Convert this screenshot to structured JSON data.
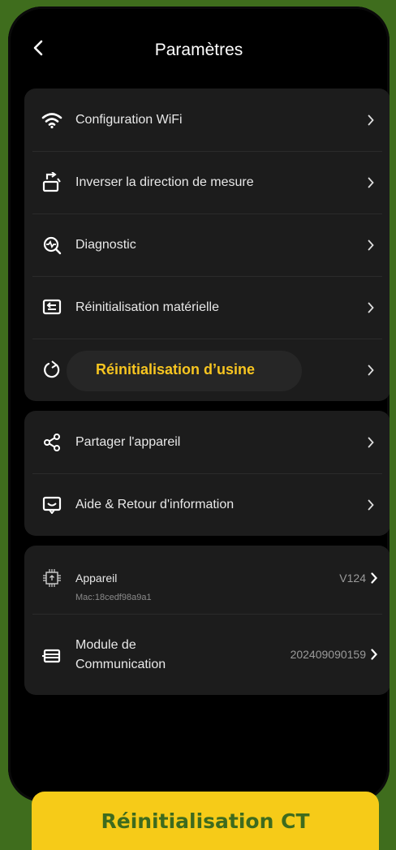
{
  "header": {
    "title": "Paramètres",
    "back_icon": "chevron-left-icon"
  },
  "settings_group1": {
    "items": [
      {
        "label": "Configuration WiFi",
        "icon": "wifi-icon"
      },
      {
        "label": "Inverser la direction de mesure",
        "icon": "rotate-device-icon"
      },
      {
        "label": "Diagnostic",
        "icon": "diagnostic-icon"
      },
      {
        "label": "Réinitialisation matérielle",
        "icon": "hardware-reset-icon"
      },
      {
        "label": "Réinitialisation d’usine",
        "icon": "factory-reset-icon",
        "highlighted": true
      }
    ]
  },
  "settings_group2": {
    "items": [
      {
        "label": "Partager l'appareil",
        "icon": "share-icon"
      },
      {
        "label": "Aide & Retour d'information",
        "icon": "feedback-icon"
      }
    ]
  },
  "device_group": {
    "device": {
      "label": "Appareil",
      "mac": "Mac:18cedf98a9a1",
      "version": "V124",
      "icon": "chip-icon"
    },
    "module": {
      "label_line1": "Module de",
      "label_line2": "Communication",
      "version": "202409090159",
      "icon": "module-icon"
    }
  },
  "banner": {
    "text": "Réinitialisation CT"
  },
  "colors": {
    "accent": "#f7c520",
    "background_green": "#3f6d1d",
    "banner_yellow": "#f6cb18",
    "card": "#1c1c1c"
  }
}
